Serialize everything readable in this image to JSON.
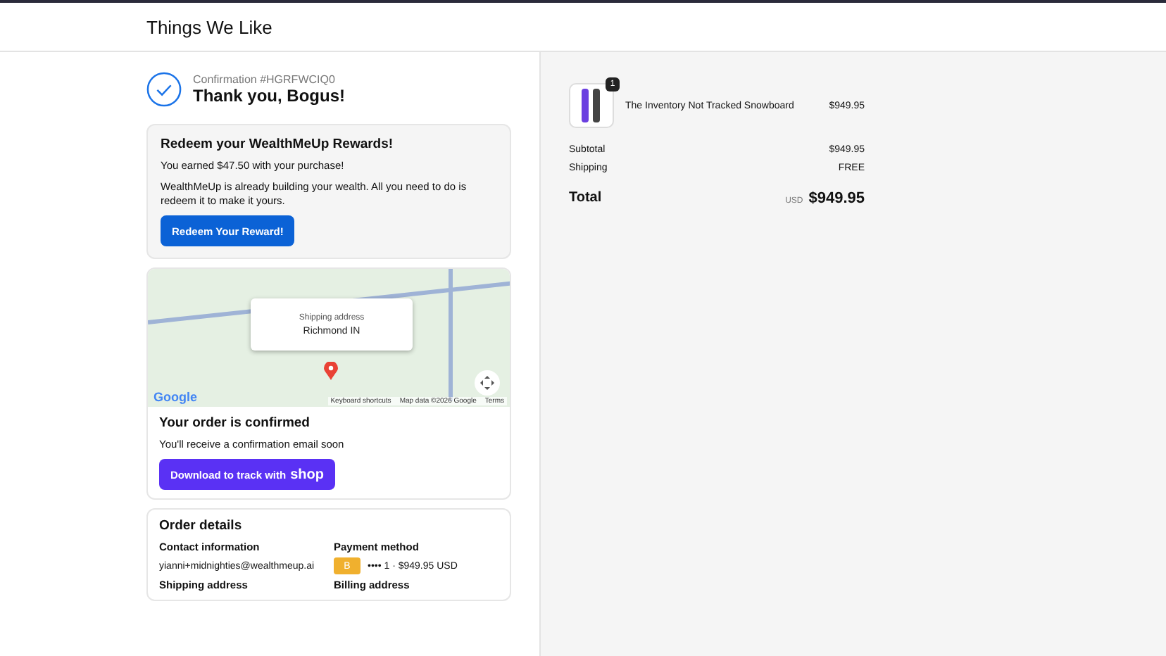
{
  "header": {
    "title": "Things We Like"
  },
  "confirmation": {
    "number": "Confirmation #HGRFWCIQ0",
    "greeting": "Thank you, Bogus!"
  },
  "rewards": {
    "title": "Redeem your WealthMeUp Rewards!",
    "earned": "You earned $47.50 with your purchase!",
    "body": "WealthMeUp is already building your wealth. All you need to do is redeem it to make it yours.",
    "button": "Redeem Your Reward!"
  },
  "map": {
    "logo": "Google",
    "popup_label": "Shipping address",
    "popup_value": "Richmond IN",
    "attribution": [
      "Keyboard shortcuts",
      "Map data ©2026 Google",
      "Terms"
    ]
  },
  "order_status": {
    "title": "Your order is confirmed",
    "message": "You'll receive a confirmation email soon",
    "button": "Download to track with",
    "button_brand": "shop"
  },
  "order_details": {
    "title": "Order details",
    "contact_label": "Contact information",
    "contact_value": "yianni+midnighties@wealthmeup.ai",
    "payment_label": "Payment method",
    "payment_badge": "B",
    "payment_value": "•••• 1 · $949.95 USD",
    "shipping_label": "Shipping address",
    "billing_label": "Billing address"
  },
  "summary": {
    "items": [
      {
        "name": "The Inventory Not Tracked Snowboard",
        "price": "$949.95",
        "quantity": "1"
      }
    ],
    "lines": [
      {
        "label": "Subtotal",
        "value": "$949.95"
      },
      {
        "label": "Shipping",
        "value": "FREE"
      }
    ],
    "total_label": "Total",
    "currency": "USD",
    "total": "$949.95"
  }
}
